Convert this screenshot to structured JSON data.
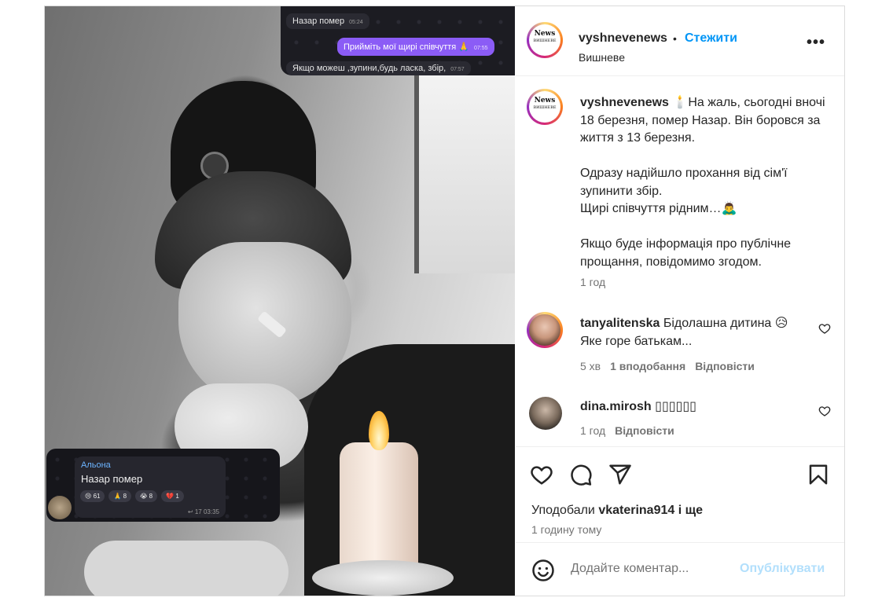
{
  "post": {
    "username": "vyshnevenews",
    "follow_label": "Стежити",
    "separator": "•",
    "location": "Вишневе",
    "logo_text": "News",
    "logo_sub": "ВИШНЕВЕ",
    "caption": {
      "username": "vyshnevenews",
      "text": " 🕯️На жаль, сьогодні вночі 18 березня, помер Назар. Він боровся за життя з 13 березня.\n\nОдразу надійшло прохання від сім'ї зупинити збір.\nЩирі співчуття рідним…🙇‍♂️\n\nЯкщо буде інформація про публічне прощання, повідомимо згодом.",
      "time": "1 год"
    },
    "comments": [
      {
        "username": "tanyalitenska",
        "text": " Бідолашна дитина 😥 Яке горе батькам...",
        "time": "5 хв",
        "likes": "1 вподобання",
        "reply": "Відповісти"
      },
      {
        "username": "dina.mirosh",
        "text": " ▯▯▯▯▯▯",
        "time": "1 год",
        "reply": "Відповісти"
      }
    ],
    "likes_prefix": "Уподобали ",
    "likes_user": "vkaterina914",
    "likes_suffix": " і ще",
    "posted_ago": "1 годину тому",
    "comment_placeholder": "Додайте коментар...",
    "publish_label": "Опублікувати"
  },
  "image_overlay": {
    "top_messages": [
      {
        "text": "Назар помер",
        "time": "05:24"
      },
      {
        "text": "Прийміть мої щирі співчуття 🙏",
        "time": "07:55"
      },
      {
        "text": "Якщо можеш ,зупини,будь ласка, збір,",
        "time": "07:57"
      }
    ],
    "bottom_chat": {
      "sender": "Альона",
      "message": "Назар помер",
      "reactions": [
        "😢 61",
        "🙏 8",
        "😭 8",
        "💔 1"
      ],
      "time": "↩ 17  03:35"
    }
  },
  "icons": {
    "more": "more-options-icon",
    "heart": "heart-icon",
    "comment": "comment-icon",
    "share": "share-icon",
    "save": "bookmark-icon",
    "emoji": "emoji-icon"
  },
  "colors": {
    "link": "#0095f6",
    "publish_disabled": "#b2dffc",
    "telegram_accent": "#8b5cf6"
  }
}
